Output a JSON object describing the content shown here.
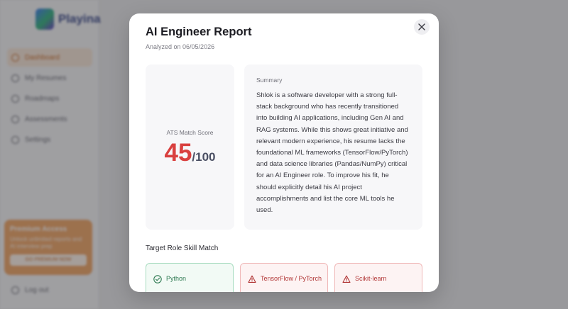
{
  "app": {
    "brand": "Playina",
    "nav": [
      {
        "label": "Dashboard",
        "active": true
      },
      {
        "label": "My Resumes",
        "active": false
      },
      {
        "label": "Roadmaps",
        "active": false
      },
      {
        "label": "Assessments",
        "active": false
      },
      {
        "label": "Settings",
        "active": false
      }
    ],
    "promo": {
      "title": "Premium Access",
      "text": "Unlock unlimited reports and AI interview prep",
      "button": "GO PREMIUM NOW"
    },
    "logout": "Log out"
  },
  "modal": {
    "title": "AI Engineer Report",
    "subtitle": "Analyzed on 06/05/2026",
    "close_label": "×"
  },
  "score": {
    "label": "ATS Match Score",
    "value": "45",
    "max": "/100",
    "color": "#d9403f"
  },
  "summary": {
    "label": "Summary",
    "text": "Shlok is a software developer with a strong full-stack background who has recently transitioned into building AI applications, including Gen AI and RAG systems. While this shows great initiative and relevant modern experience, his resume lacks the foundational ML frameworks (TensorFlow/PyTorch) and data science libraries (Pandas/NumPy) critical for an AI Engineer role. To improve his fit, he should explicitly detail his AI project accomplishments and list the core ML tools he used."
  },
  "skills": {
    "title": "Target Role Skill Match",
    "items": [
      {
        "name": "Python",
        "status": "matched",
        "icon": "check-circle-icon"
      },
      {
        "name": "TensorFlow / PyTorch",
        "status": "missing",
        "icon": "warning-triangle-icon"
      },
      {
        "name": "Scikit-learn",
        "status": "missing",
        "icon": "warning-triangle-icon"
      }
    ]
  },
  "colors": {
    "accent": "#c76b28",
    "matched": "#2f7a52",
    "missing": "#b23838"
  }
}
